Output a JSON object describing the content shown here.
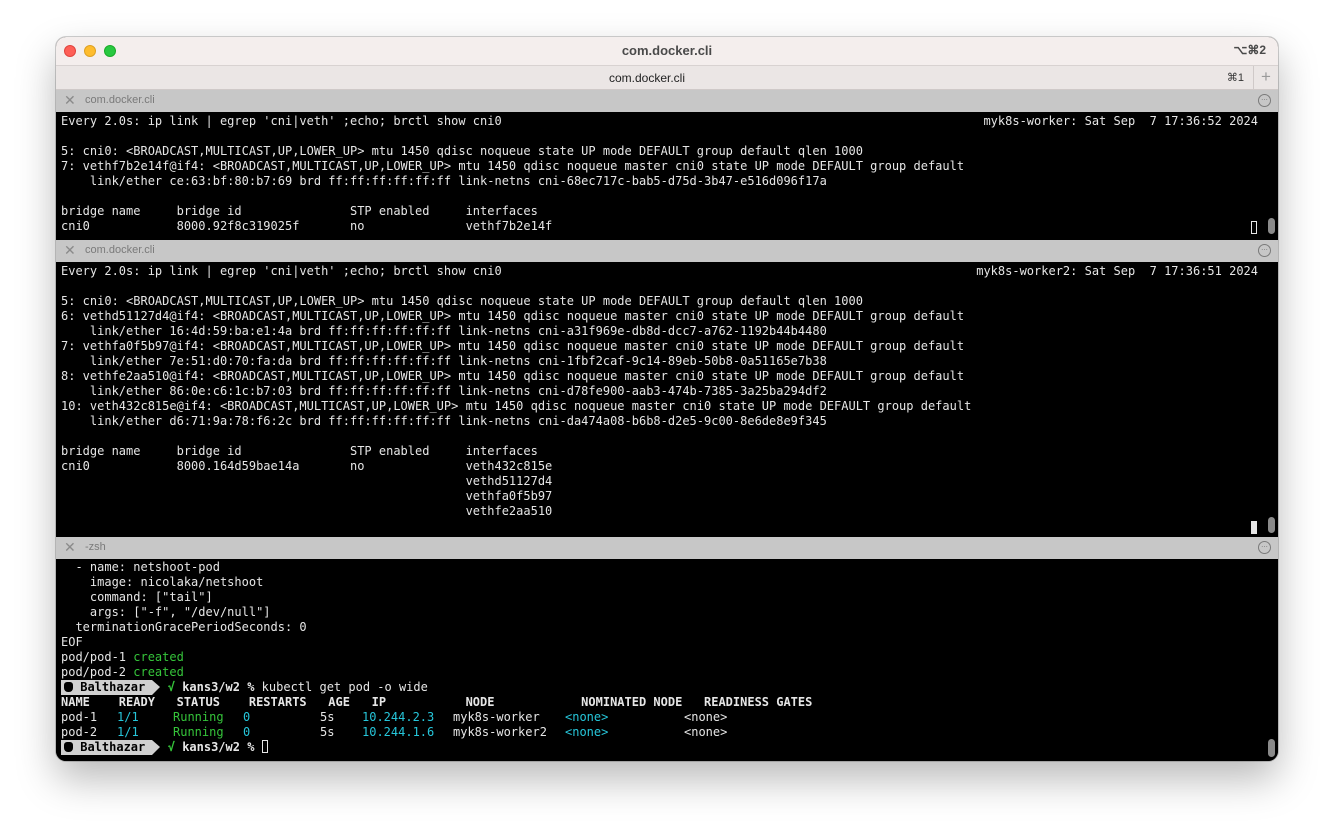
{
  "window": {
    "title": "com.docker.cli",
    "shortcut": "⌥⌘2",
    "tab_label": "com.docker.cli",
    "tab_shortcut": "⌘1",
    "new_tab_symbol": "+",
    "close_symbol": "✕"
  },
  "pane1": {
    "title": "com.docker.cli",
    "watch_cmd": "Every 2.0s: ip link | egrep 'cni|veth' ;echo; brctl show cni0",
    "host_time": "myk8s-worker: Sat Sep  7 17:36:52 2024",
    "lines": [
      "5: cni0: <BROADCAST,MULTICAST,UP,LOWER_UP> mtu 1450 qdisc noqueue state UP mode DEFAULT group default qlen 1000",
      "7: vethf7b2e14f@if4: <BROADCAST,MULTICAST,UP,LOWER_UP> mtu 1450 qdisc noqueue master cni0 state UP mode DEFAULT group default",
      "    link/ether ce:63:bf:80:b7:69 brd ff:ff:ff:ff:ff:ff link-netns cni-68ec717c-bab5-d75d-3b47-e516d096f17a"
    ],
    "bridge_header": "bridge name     bridge id               STP enabled     interfaces",
    "bridge_rows": [
      "cni0            8000.92f8c319025f       no              vethf7b2e14f"
    ]
  },
  "pane2": {
    "title": "com.docker.cli",
    "watch_cmd": "Every 2.0s: ip link | egrep 'cni|veth' ;echo; brctl show cni0",
    "host_time": "myk8s-worker2: Sat Sep  7 17:36:51 2024",
    "lines": [
      "5: cni0: <BROADCAST,MULTICAST,UP,LOWER_UP> mtu 1450 qdisc noqueue state UP mode DEFAULT group default qlen 1000",
      "6: vethd51127d4@if4: <BROADCAST,MULTICAST,UP,LOWER_UP> mtu 1450 qdisc noqueue master cni0 state UP mode DEFAULT group default",
      "    link/ether 16:4d:59:ba:e1:4a brd ff:ff:ff:ff:ff:ff link-netns cni-a31f969e-db8d-dcc7-a762-1192b44b4480",
      "7: vethfa0f5b97@if4: <BROADCAST,MULTICAST,UP,LOWER_UP> mtu 1450 qdisc noqueue master cni0 state UP mode DEFAULT group default",
      "    link/ether 7e:51:d0:70:fa:da brd ff:ff:ff:ff:ff:ff link-netns cni-1fbf2caf-9c14-89eb-50b8-0a51165e7b38",
      "8: vethfe2aa510@if4: <BROADCAST,MULTICAST,UP,LOWER_UP> mtu 1450 qdisc noqueue master cni0 state UP mode DEFAULT group default",
      "    link/ether 86:0e:c6:1c:b7:03 brd ff:ff:ff:ff:ff:ff link-netns cni-d78fe900-aab3-474b-7385-3a25ba294df2",
      "10: veth432c815e@if4: <BROADCAST,MULTICAST,UP,LOWER_UP> mtu 1450 qdisc noqueue master cni0 state UP mode DEFAULT group default",
      "    link/ether d6:71:9a:78:f6:2c brd ff:ff:ff:ff:ff:ff link-netns cni-da474a08-b6b8-d2e5-9c00-8e6de8e9f345"
    ],
    "bridge_header": "bridge name     bridge id               STP enabled     interfaces",
    "bridge_rows": [
      "cni0            8000.164d59bae14a       no              veth432c815e",
      "                                                        vethd51127d4",
      "                                                        vethfa0f5b97",
      "                                                        vethfe2aa510"
    ]
  },
  "pane3": {
    "title": "-zsh",
    "yaml_lines": [
      "  - name: netshoot-pod",
      "    image: nicolaka/netshoot",
      "    command: [\"tail\"]",
      "    args: [\"-f\", \"/dev/null\"]",
      "  terminationGracePeriodSeconds: 0",
      "EOF"
    ],
    "created1_name": "pod/pod-1 ",
    "created2_name": "pod/pod-2 ",
    "created_word": "created",
    "prompt_user": " Balthazar",
    "prompt_check": "√",
    "prompt_dir": "kans3/w2 %",
    "command": "kubectl get pod -o wide",
    "table_header": "NAME    READY   STATUS    RESTARTS   AGE   IP           NODE            NOMINATED NODE   READINESS GATES",
    "pods": [
      {
        "name": "pod-1",
        "ready": "1/1",
        "status": "Running",
        "restarts": "0",
        "age": "5s",
        "ip": "10.244.2.3",
        "node": "myk8s-worker",
        "nominated": "<none>",
        "gates": "<none>"
      },
      {
        "name": "pod-2",
        "ready": "1/1",
        "status": "Running",
        "restarts": "0",
        "age": "5s",
        "ip": "10.244.1.6",
        "node": "myk8s-worker2",
        "nominated": "<none>",
        "gates": "<none>"
      }
    ]
  }
}
